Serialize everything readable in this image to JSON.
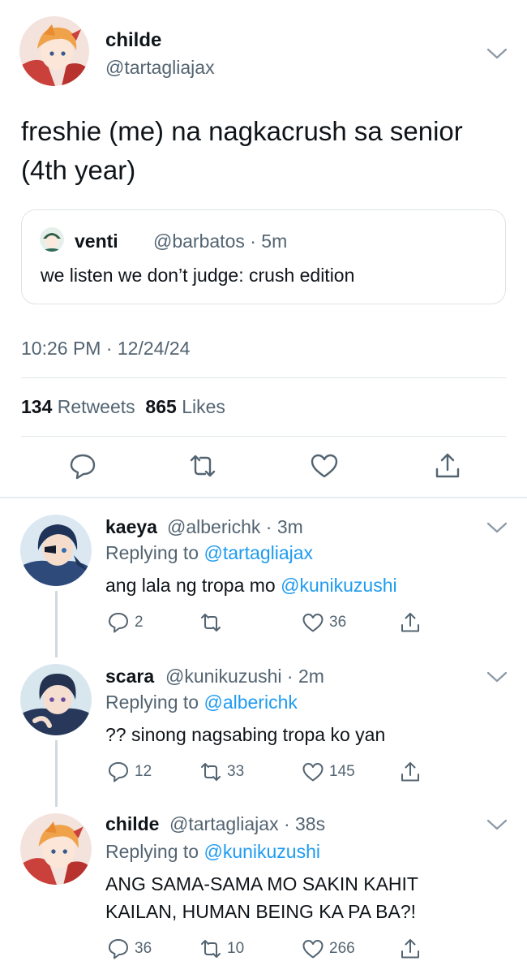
{
  "colors": {
    "link": "#1d9bf0",
    "muted": "#536471",
    "text": "#0f1419",
    "border": "#dfe3e7"
  },
  "main": {
    "author_name": "childe",
    "author_handle": "@tartagliajax",
    "text_line1": "freshie (me) na nagkacrush sa senior",
    "text_line2": "(4th year)",
    "quote": {
      "name": "venti",
      "handle_time": "@barbatos · 5m",
      "text": "we listen we don’t judge: crush edition"
    },
    "timestamp": "10:26 PM · 12/24/24",
    "retweets_count": "134",
    "retweets_label": "Retweets",
    "likes_count": "865",
    "likes_label": "Likes",
    "icons": [
      "reply-icon",
      "retweet-icon",
      "like-icon",
      "share-icon"
    ]
  },
  "replies": [
    {
      "name": "kaeya",
      "handle_time": "@alberichk · 3m",
      "replying_prefix": "Replying to",
      "replying_to": "@tartagliajax",
      "text": "ang lala ng tropa mo",
      "mention": "@kunikuzushi",
      "reply_count": "2",
      "retweet_count": "",
      "like_count": "36"
    },
    {
      "name": "scara",
      "handle_time": "@kunikuzushi · 2m",
      "replying_prefix": "Replying to",
      "replying_to": "@alberichk",
      "text": "?? sinong nagsabing tropa ko yan",
      "reply_count": "12",
      "retweet_count": "33",
      "like_count": "145"
    },
    {
      "name": "childe",
      "handle_time": "@tartagliajax · 38s",
      "replying_prefix": "Replying to",
      "replying_to": "@kunikuzushi",
      "text_line1": "ANG SAMA-SAMA MO SAKIN KAHIT",
      "text_line2": "KAILAN, HUMAN BEING KA PA BA?!",
      "reply_count": "36",
      "retweet_count": "10",
      "like_count": "266"
    }
  ]
}
